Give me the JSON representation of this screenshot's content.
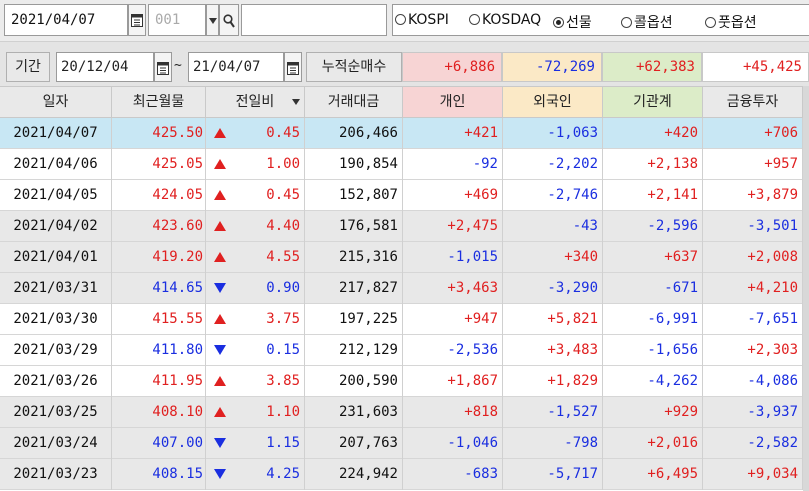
{
  "toolbar": {
    "date": "2021/04/07",
    "code_placeholder": "001",
    "name_value": "",
    "radios": [
      {
        "label": "KOSPI",
        "checked": false
      },
      {
        "label": "KOSDAQ",
        "checked": false
      },
      {
        "label": "선물",
        "checked": true
      },
      {
        "label": "콜옵션",
        "checked": false
      },
      {
        "label": "풋옵션",
        "checked": false
      }
    ]
  },
  "period": {
    "label": "기간",
    "start": "20/12/04",
    "end": "21/04/07",
    "tilde": "~",
    "cum_label": "누적순매수",
    "sums": {
      "individual": "+6,886",
      "foreign": "-72,269",
      "institution": "+62,383",
      "financial": "+45,425"
    }
  },
  "colors": {
    "up": "#e02020",
    "down": "#1a2ee0",
    "selected_row": "#c8e7f4",
    "individual_header": "#f7d4d4",
    "foreign_header": "#fbe9c6",
    "institution_header": "#dcecc8"
  },
  "table": {
    "headers": {
      "date": "일자",
      "price": "최근월물",
      "change": "전일비",
      "volume": "거래대금",
      "individual": "개인",
      "foreign": "외국인",
      "institution": "기관계",
      "financial": "금융투자"
    },
    "rows": [
      {
        "date": "2021/04/07",
        "price": "425.50",
        "dir": "up",
        "change": "0.45",
        "volume": "206,466",
        "individual": "+421",
        "foreign": "-1,063",
        "institution": "+420",
        "financial": "+706"
      },
      {
        "date": "2021/04/06",
        "price": "425.05",
        "dir": "up",
        "change": "1.00",
        "volume": "190,854",
        "individual": "-92",
        "foreign": "-2,202",
        "institution": "+2,138",
        "financial": "+957"
      },
      {
        "date": "2021/04/05",
        "price": "424.05",
        "dir": "up",
        "change": "0.45",
        "volume": "152,807",
        "individual": "+469",
        "foreign": "-2,746",
        "institution": "+2,141",
        "financial": "+3,879"
      },
      {
        "date": "2021/04/02",
        "price": "423.60",
        "dir": "up",
        "change": "4.40",
        "volume": "176,581",
        "individual": "+2,475",
        "foreign": "-43",
        "institution": "-2,596",
        "financial": "-3,501"
      },
      {
        "date": "2021/04/01",
        "price": "419.20",
        "dir": "up",
        "change": "4.55",
        "volume": "215,316",
        "individual": "-1,015",
        "foreign": "+340",
        "institution": "+637",
        "financial": "+2,008"
      },
      {
        "date": "2021/03/31",
        "price": "414.65",
        "dir": "down",
        "change": "0.90",
        "volume": "217,827",
        "individual": "+3,463",
        "foreign": "-3,290",
        "institution": "-671",
        "financial": "+4,210"
      },
      {
        "date": "2021/03/30",
        "price": "415.55",
        "dir": "up",
        "change": "3.75",
        "volume": "197,225",
        "individual": "+947",
        "foreign": "+5,821",
        "institution": "-6,991",
        "financial": "-7,651"
      },
      {
        "date": "2021/03/29",
        "price": "411.80",
        "dir": "down",
        "change": "0.15",
        "volume": "212,129",
        "individual": "-2,536",
        "foreign": "+3,483",
        "institution": "-1,656",
        "financial": "+2,303"
      },
      {
        "date": "2021/03/26",
        "price": "411.95",
        "dir": "up",
        "change": "3.85",
        "volume": "200,590",
        "individual": "+1,867",
        "foreign": "+1,829",
        "institution": "-4,262",
        "financial": "-4,086"
      },
      {
        "date": "2021/03/25",
        "price": "408.10",
        "dir": "up",
        "change": "1.10",
        "volume": "231,603",
        "individual": "+818",
        "foreign": "-1,527",
        "institution": "+929",
        "financial": "-3,937"
      },
      {
        "date": "2021/03/24",
        "price": "407.00",
        "dir": "down",
        "change": "1.15",
        "volume": "207,763",
        "individual": "-1,046",
        "foreign": "-798",
        "institution": "+2,016",
        "financial": "-2,582"
      },
      {
        "date": "2021/03/23",
        "price": "408.15",
        "dir": "down",
        "change": "4.25",
        "volume": "224,942",
        "individual": "-683",
        "foreign": "-5,717",
        "institution": "+6,495",
        "financial": "+9,034"
      }
    ]
  }
}
